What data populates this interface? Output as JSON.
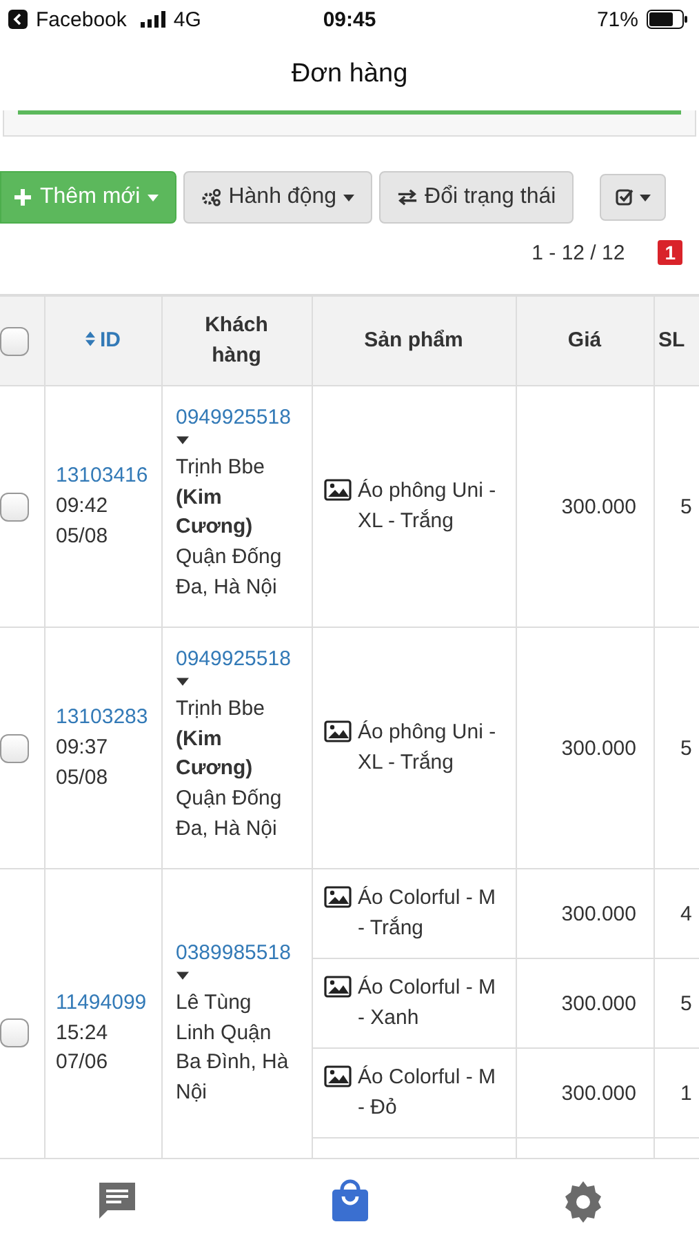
{
  "status_bar": {
    "back_app": "Facebook",
    "network": "4G",
    "time": "09:45",
    "battery": "71%"
  },
  "title": "Đơn hàng",
  "toolbar": [
    {
      "label": "Thêm mới",
      "kind": "add",
      "dropdown": true
    },
    {
      "label": "Hành động",
      "kind": "actions",
      "dropdown": true
    },
    {
      "label": "Đổi trạng thái",
      "kind": "switch",
      "dropdown": false
    }
  ],
  "pagination": {
    "range": "1 - 12 / 12",
    "page": "1"
  },
  "select_all": {
    "checked": false
  },
  "columns": [
    {
      "label": "ID",
      "sortable": true
    },
    {
      "label": "Khách hàng",
      "sortable": false
    },
    {
      "label": "Sản phẩm",
      "sortable": false
    },
    {
      "label": "Giá",
      "sortable": false
    },
    {
      "label": "SL",
      "sortable": false
    }
  ],
  "orders": [
    {
      "checked": false,
      "id": "13103416",
      "time": "09:42",
      "date": "05/08",
      "phone": "0949925518",
      "customer": "Trịnh Bbe **(Kim Cương)** Quận Đống Đa, Hà Nội",
      "items": [
        {
          "product": "Áo phông Uni - XL - Trắng",
          "price": "300.000",
          "qty": "5"
        }
      ]
    },
    {
      "checked": false,
      "id": "13103283",
      "time": "09:37",
      "date": "05/08",
      "phone": "0949925518",
      "customer": "Trịnh Bbe **(Kim Cương)** Quận Đống Đa, Hà Nội",
      "items": [
        {
          "product": "Áo phông Uni - XL - Trắng",
          "price": "300.000",
          "qty": "5"
        }
      ]
    },
    {
      "checked": false,
      "id": "11494099",
      "time": "15:24",
      "date": "07/06",
      "phone": "0389985518",
      "customer": "Lê Tùng Linh Quận Ba Đình, Hà Nội",
      "items": [
        {
          "product": "Áo Colorful - M - Trắng",
          "price": "300.000",
          "qty": "4"
        },
        {
          "product": "Áo Colorful - M - Xanh",
          "price": "300.000",
          "qty": "5"
        },
        {
          "product": "Áo Colorful - M - Đỏ",
          "price": "300.000",
          "qty": "1"
        }
      ]
    }
  ],
  "tabs": [
    {
      "kind": "chat",
      "selected": false
    },
    {
      "kind": "bag",
      "selected": true
    },
    {
      "kind": "settings",
      "selected": false
    }
  ]
}
